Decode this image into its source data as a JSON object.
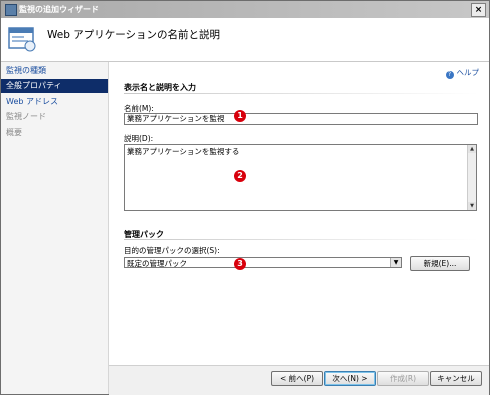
{
  "window": {
    "title": "監視の追加ウィザード",
    "close_label": "×"
  },
  "header": {
    "title": "Web アプリケーションの名前と説明"
  },
  "sidebar": {
    "items": [
      {
        "label": "監視の種類",
        "state": "link"
      },
      {
        "label": "全般プロパティ",
        "state": "active"
      },
      {
        "label": "Web アドレス",
        "state": "link"
      },
      {
        "label": "監視ノード",
        "state": "disabled"
      },
      {
        "label": "概要",
        "state": "disabled"
      }
    ]
  },
  "help": {
    "label": "ヘルプ"
  },
  "name_section": {
    "heading": "表示名と説明を入力",
    "name_label": "名前(M):",
    "name_value": "業務アプリケーションを監視",
    "description_label": "説明(D):",
    "description_value": "業務アプリケーションを監視する"
  },
  "pack_section": {
    "heading": "管理パック",
    "select_label": "目的の管理パックの選択(S):",
    "selected_pack": "既定の管理パック",
    "new_button": "新規(E)..."
  },
  "markers": [
    "1",
    "2",
    "3"
  ],
  "footer": {
    "back": "< 前へ(P)",
    "next": "次へ(N) >",
    "create": "作成(R)",
    "cancel": "キャンセル"
  }
}
